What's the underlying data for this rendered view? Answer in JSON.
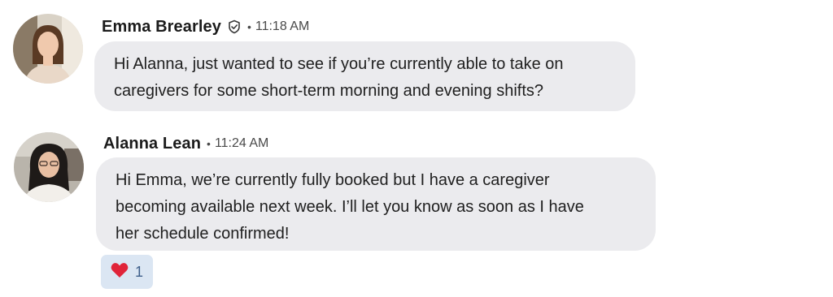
{
  "messages": [
    {
      "sender": "Emma Brearley",
      "verified": true,
      "separator": "•",
      "time": "11:18 AM",
      "text_lines": [
        "Hi Alanna, just wanted to see if you’re currently able to take on",
        "caregivers for some short-term morning and evening shifts?"
      ],
      "avatar_icon": "avatar-photo"
    },
    {
      "sender": "Alanna Lean",
      "verified": false,
      "separator": "•",
      "time": "11:24 AM",
      "text_lines": [
        "Hi Emma, we’re currently fully booked but I have a caregiver",
        "becoming available next week. I’ll let you know as soon as I have",
        "her schedule confirmed!"
      ],
      "avatar_icon": "avatar-photo",
      "reaction": {
        "icon": "heart-icon",
        "count": "1",
        "color": "#e0243a"
      }
    }
  ],
  "colors": {
    "bubble": "#ebebee",
    "reaction_bg": "#dbe6f3",
    "reaction_count": "#3e5f8a"
  }
}
